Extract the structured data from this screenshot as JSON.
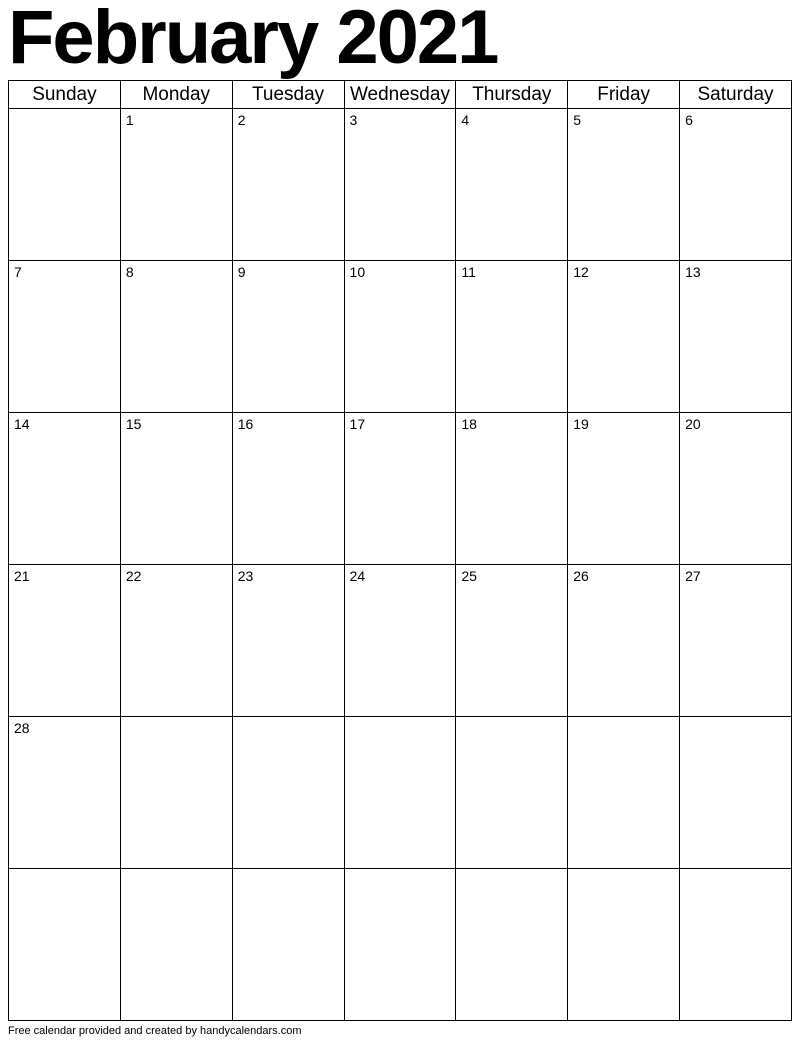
{
  "title": "February 2021",
  "day_headers": [
    "Sunday",
    "Monday",
    "Tuesday",
    "Wednesday",
    "Thursday",
    "Friday",
    "Saturday"
  ],
  "weeks": [
    [
      "",
      "1",
      "2",
      "3",
      "4",
      "5",
      "6"
    ],
    [
      "7",
      "8",
      "9",
      "10",
      "11",
      "12",
      "13"
    ],
    [
      "14",
      "15",
      "16",
      "17",
      "18",
      "19",
      "20"
    ],
    [
      "21",
      "22",
      "23",
      "24",
      "25",
      "26",
      "27"
    ],
    [
      "28",
      "",
      "",
      "",
      "",
      "",
      ""
    ],
    [
      "",
      "",
      "",
      "",
      "",
      "",
      ""
    ]
  ],
  "footer": "Free calendar provided and created by handycalendars.com"
}
